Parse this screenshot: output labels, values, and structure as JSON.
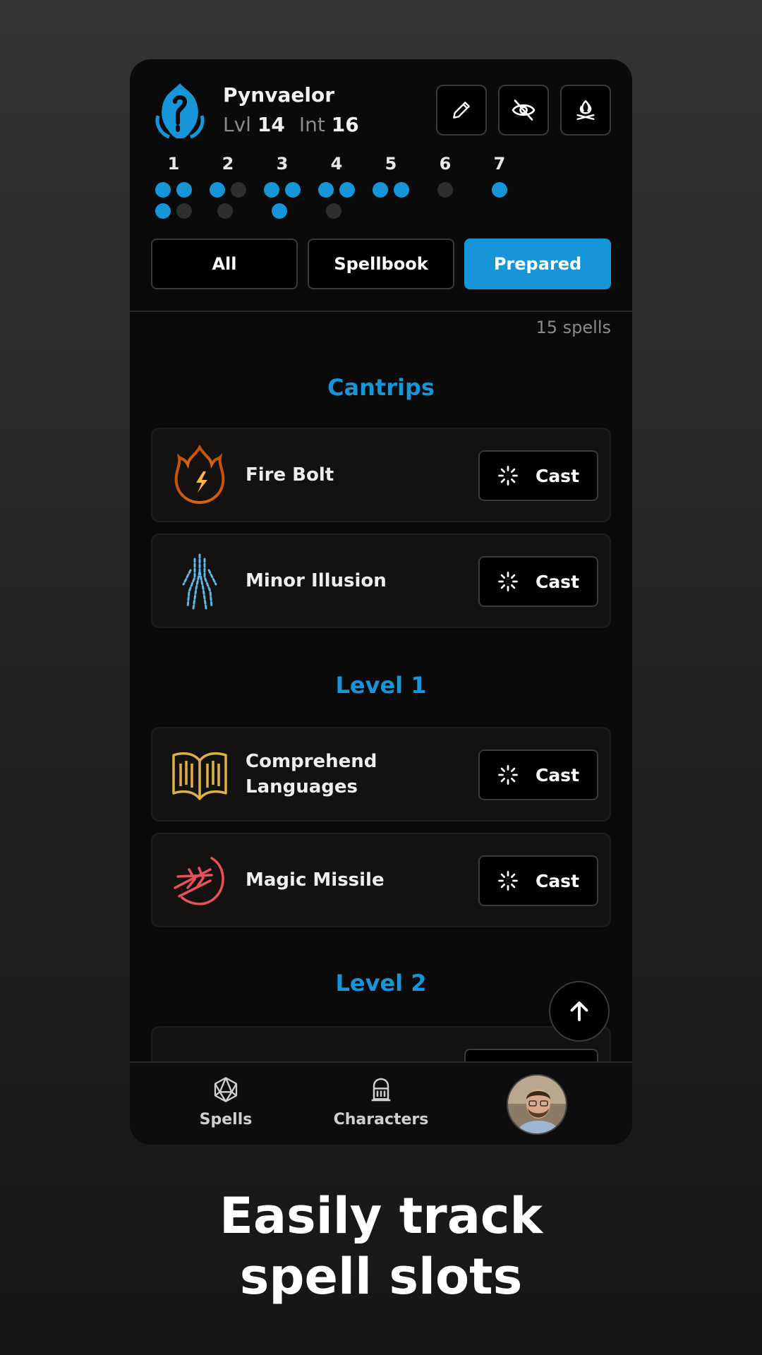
{
  "character": {
    "name": "Pynvaelor",
    "lvl_label": "Lvl",
    "lvl_value": "14",
    "int_label": "Int",
    "int_value": "16"
  },
  "header_icons": [
    "edit-icon",
    "hide-icon",
    "rest-campfire-icon"
  ],
  "spell_slots": [
    {
      "level": "1",
      "total": 4,
      "available": 3
    },
    {
      "level": "2",
      "total": 3,
      "available": 1
    },
    {
      "level": "3",
      "total": 3,
      "available": 3
    },
    {
      "level": "4",
      "total": 3,
      "available": 2
    },
    {
      "level": "5",
      "total": 2,
      "available": 2
    },
    {
      "level": "6",
      "total": 1,
      "available": 0
    },
    {
      "level": "7",
      "total": 1,
      "available": 1
    }
  ],
  "filters": {
    "all": "All",
    "spellbook": "Spellbook",
    "prepared": "Prepared",
    "active": "prepared"
  },
  "spell_count": "15 spells",
  "sections": {
    "cantrips": "Cantrips",
    "level1": "Level 1",
    "level2": "Level 2"
  },
  "spells": {
    "fire_bolt": {
      "name": "Fire Bolt",
      "cast": "Cast"
    },
    "minor_illusion": {
      "name": "Minor Illusion",
      "cast": "Cast"
    },
    "comprehend_languages": {
      "name": "Comprehend Languages",
      "cast": "Cast"
    },
    "magic_missile": {
      "name": "Magic Missile",
      "cast": "Cast"
    }
  },
  "nav": {
    "spells": "Spells",
    "characters": "Characters"
  },
  "tagline": {
    "line1": "Easily track",
    "line2": "spell slots"
  },
  "colors": {
    "accent": "#1696d8",
    "card": "#131211",
    "background": "#0a0a0a"
  }
}
